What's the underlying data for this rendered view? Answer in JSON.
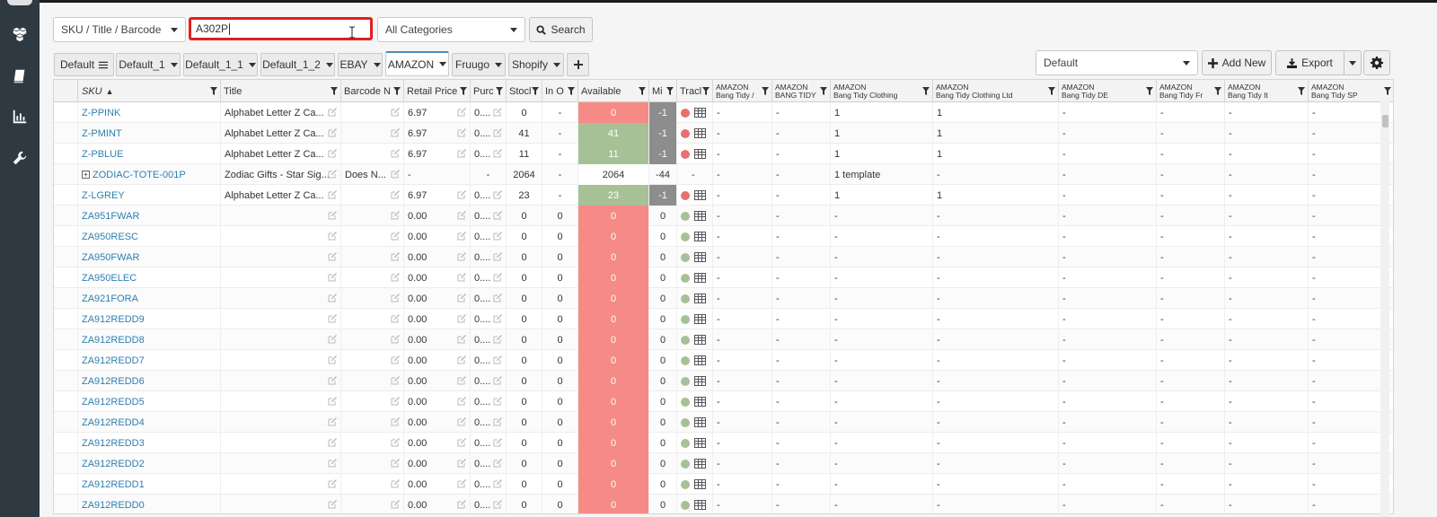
{
  "sidebar": {
    "items": [
      "boxes-icon",
      "book-icon",
      "chart-icon",
      "wrench-icon"
    ]
  },
  "filters": {
    "field_select": "SKU / Title / Barcode",
    "search_value": "A302P",
    "category_select": "All Categories",
    "search_label": "Search"
  },
  "tabs": [
    {
      "label": "Default",
      "active": false
    },
    {
      "label": "Default_1",
      "active": false
    },
    {
      "label": "Default_1_1",
      "active": false
    },
    {
      "label": "Default_1_2",
      "active": false
    },
    {
      "label": "EBAY",
      "active": false
    },
    {
      "label": "AMAZON",
      "active": true
    },
    {
      "label": "Fruugo",
      "active": false
    },
    {
      "label": "Shopify",
      "active": false
    }
  ],
  "toolbar": {
    "view_select": "Default",
    "add_new": "Add New",
    "export": "Export"
  },
  "columns": [
    "SKU",
    "Title",
    "Barcode N",
    "Retail Price",
    "Purc",
    "Stocl",
    "In O",
    "Available",
    "Mi",
    "Tracl",
    "AMAZON|Bang Tidy /",
    "AMAZON|BANG TIDY",
    "AMAZON|Bang Tidy Clothing",
    "AMAZON|Bang Tidy Clothing Ltd",
    "AMAZON|Bang Tidy DE",
    "AMAZON|Bang Tidy Fr",
    "AMAZON|Bang Tidy It",
    "AMAZON|Bang Tidy SP"
  ],
  "rows": [
    {
      "sku": "Z-PPINK",
      "title": "Alphabet Letter Z Ca...",
      "barcode": "",
      "price": "6.97",
      "purc": "0....",
      "stock": "0",
      "inorder": "-",
      "available": "0",
      "avail_color": "red",
      "mi": "-1",
      "track": "red",
      "a1": "-",
      "a2": "-",
      "a3": "1",
      "a4": "1",
      "a5": "-",
      "a6": "-",
      "a7": "-",
      "a8": "-",
      "expand": false
    },
    {
      "sku": "Z-PMINT",
      "title": "Alphabet Letter Z Ca...",
      "barcode": "",
      "price": "6.97",
      "purc": "0....",
      "stock": "41",
      "inorder": "-",
      "available": "41",
      "avail_color": "green",
      "mi": "-1",
      "track": "red",
      "a1": "-",
      "a2": "-",
      "a3": "1",
      "a4": "1",
      "a5": "-",
      "a6": "-",
      "a7": "-",
      "a8": "-",
      "expand": false
    },
    {
      "sku": "Z-PBLUE",
      "title": "Alphabet Letter Z Ca...",
      "barcode": "",
      "price": "6.97",
      "purc": "0....",
      "stock": "11",
      "inorder": "-",
      "available": "11",
      "avail_color": "green",
      "mi": "-1",
      "track": "red",
      "a1": "-",
      "a2": "-",
      "a3": "1",
      "a4": "1",
      "a5": "-",
      "a6": "-",
      "a7": "-",
      "a8": "-",
      "expand": false
    },
    {
      "sku": "ZODIAC-TOTE-001P",
      "title": "Zodiac Gifts - Star Sig...",
      "barcode": "Does N...",
      "price": "-",
      "purc": "-",
      "stock": "2064",
      "inorder": "-",
      "available": "2064",
      "avail_color": "white",
      "mi": "-44",
      "track": "none",
      "a1": "-",
      "a2": "-",
      "a3": "1 template",
      "a4": "-",
      "a5": "-",
      "a6": "-",
      "a7": "-",
      "a8": "-",
      "expand": true
    },
    {
      "sku": "Z-LGREY",
      "title": "Alphabet Letter Z Ca...",
      "barcode": "",
      "price": "6.97",
      "purc": "0....",
      "stock": "23",
      "inorder": "-",
      "available": "23",
      "avail_color": "green",
      "mi": "-1",
      "track": "red",
      "a1": "-",
      "a2": "-",
      "a3": "1",
      "a4": "1",
      "a5": "-",
      "a6": "-",
      "a7": "-",
      "a8": "-",
      "expand": false
    },
    {
      "sku": "ZA951FWAR",
      "title": "",
      "barcode": "",
      "price": "0.00",
      "purc": "0....",
      "stock": "0",
      "inorder": "0",
      "available": "0",
      "avail_color": "red",
      "mi": "0",
      "track": "green",
      "a1": "-",
      "a2": "-",
      "a3": "-",
      "a4": "-",
      "a5": "-",
      "a6": "-",
      "a7": "-",
      "a8": "-",
      "expand": false
    },
    {
      "sku": "ZA950RESC",
      "title": "",
      "barcode": "",
      "price": "0.00",
      "purc": "0....",
      "stock": "0",
      "inorder": "0",
      "available": "0",
      "avail_color": "red",
      "mi": "0",
      "track": "green",
      "a1": "-",
      "a2": "-",
      "a3": "-",
      "a4": "-",
      "a5": "-",
      "a6": "-",
      "a7": "-",
      "a8": "-",
      "expand": false
    },
    {
      "sku": "ZA950FWAR",
      "title": "",
      "barcode": "",
      "price": "0.00",
      "purc": "0....",
      "stock": "0",
      "inorder": "0",
      "available": "0",
      "avail_color": "red",
      "mi": "0",
      "track": "green",
      "a1": "-",
      "a2": "-",
      "a3": "-",
      "a4": "-",
      "a5": "-",
      "a6": "-",
      "a7": "-",
      "a8": "-",
      "expand": false
    },
    {
      "sku": "ZA950ELEC",
      "title": "",
      "barcode": "",
      "price": "0.00",
      "purc": "0....",
      "stock": "0",
      "inorder": "0",
      "available": "0",
      "avail_color": "red",
      "mi": "0",
      "track": "green",
      "a1": "-",
      "a2": "-",
      "a3": "-",
      "a4": "-",
      "a5": "-",
      "a6": "-",
      "a7": "-",
      "a8": "-",
      "expand": false
    },
    {
      "sku": "ZA921FORA",
      "title": "",
      "barcode": "",
      "price": "0.00",
      "purc": "0....",
      "stock": "0",
      "inorder": "0",
      "available": "0",
      "avail_color": "red",
      "mi": "0",
      "track": "green",
      "a1": "-",
      "a2": "-",
      "a3": "-",
      "a4": "-",
      "a5": "-",
      "a6": "-",
      "a7": "-",
      "a8": "-",
      "expand": false
    },
    {
      "sku": "ZA912REDD9",
      "title": "",
      "barcode": "",
      "price": "0.00",
      "purc": "0....",
      "stock": "0",
      "inorder": "0",
      "available": "0",
      "avail_color": "red",
      "mi": "0",
      "track": "green",
      "a1": "-",
      "a2": "-",
      "a3": "-",
      "a4": "-",
      "a5": "-",
      "a6": "-",
      "a7": "-",
      "a8": "-",
      "expand": false
    },
    {
      "sku": "ZA912REDD8",
      "title": "",
      "barcode": "",
      "price": "0.00",
      "purc": "0....",
      "stock": "0",
      "inorder": "0",
      "available": "0",
      "avail_color": "red",
      "mi": "0",
      "track": "green",
      "a1": "-",
      "a2": "-",
      "a3": "-",
      "a4": "-",
      "a5": "-",
      "a6": "-",
      "a7": "-",
      "a8": "-",
      "expand": false
    },
    {
      "sku": "ZA912REDD7",
      "title": "",
      "barcode": "",
      "price": "0.00",
      "purc": "0....",
      "stock": "0",
      "inorder": "0",
      "available": "0",
      "avail_color": "red",
      "mi": "0",
      "track": "green",
      "a1": "-",
      "a2": "-",
      "a3": "-",
      "a4": "-",
      "a5": "-",
      "a6": "-",
      "a7": "-",
      "a8": "-",
      "expand": false
    },
    {
      "sku": "ZA912REDD6",
      "title": "",
      "barcode": "",
      "price": "0.00",
      "purc": "0....",
      "stock": "0",
      "inorder": "0",
      "available": "0",
      "avail_color": "red",
      "mi": "0",
      "track": "green",
      "a1": "-",
      "a2": "-",
      "a3": "-",
      "a4": "-",
      "a5": "-",
      "a6": "-",
      "a7": "-",
      "a8": "-",
      "expand": false
    },
    {
      "sku": "ZA912REDD5",
      "title": "",
      "barcode": "",
      "price": "0.00",
      "purc": "0....",
      "stock": "0",
      "inorder": "0",
      "available": "0",
      "avail_color": "red",
      "mi": "0",
      "track": "green",
      "a1": "-",
      "a2": "-",
      "a3": "-",
      "a4": "-",
      "a5": "-",
      "a6": "-",
      "a7": "-",
      "a8": "-",
      "expand": false
    },
    {
      "sku": "ZA912REDD4",
      "title": "",
      "barcode": "",
      "price": "0.00",
      "purc": "0....",
      "stock": "0",
      "inorder": "0",
      "available": "0",
      "avail_color": "red",
      "mi": "0",
      "track": "green",
      "a1": "-",
      "a2": "-",
      "a3": "-",
      "a4": "-",
      "a5": "-",
      "a6": "-",
      "a7": "-",
      "a8": "-",
      "expand": false
    },
    {
      "sku": "ZA912REDD3",
      "title": "",
      "barcode": "",
      "price": "0.00",
      "purc": "0....",
      "stock": "0",
      "inorder": "0",
      "available": "0",
      "avail_color": "red",
      "mi": "0",
      "track": "green",
      "a1": "-",
      "a2": "-",
      "a3": "-",
      "a4": "-",
      "a5": "-",
      "a6": "-",
      "a7": "-",
      "a8": "-",
      "expand": false
    },
    {
      "sku": "ZA912REDD2",
      "title": "",
      "barcode": "",
      "price": "0.00",
      "purc": "0....",
      "stock": "0",
      "inorder": "0",
      "available": "0",
      "avail_color": "red",
      "mi": "0",
      "track": "green",
      "a1": "-",
      "a2": "-",
      "a3": "-",
      "a4": "-",
      "a5": "-",
      "a6": "-",
      "a7": "-",
      "a8": "-",
      "expand": false
    },
    {
      "sku": "ZA912REDD1",
      "title": "",
      "barcode": "",
      "price": "0.00",
      "purc": "0....",
      "stock": "0",
      "inorder": "0",
      "available": "0",
      "avail_color": "red",
      "mi": "0",
      "track": "green",
      "a1": "-",
      "a2": "-",
      "a3": "-",
      "a4": "-",
      "a5": "-",
      "a6": "-",
      "a7": "-",
      "a8": "-",
      "expand": false
    },
    {
      "sku": "ZA912REDD0",
      "title": "",
      "barcode": "",
      "price": "0.00",
      "purc": "0....",
      "stock": "0",
      "inorder": "0",
      "available": "0",
      "avail_color": "red",
      "mi": "0",
      "track": "green",
      "a1": "-",
      "a2": "-",
      "a3": "-",
      "a4": "-",
      "a5": "-",
      "a6": "-",
      "a7": "-",
      "a8": "-",
      "expand": false
    }
  ],
  "colors": {
    "accent": "#2f7fb0",
    "available_red": "#f58a86",
    "available_green": "#a7c196",
    "track_red": "#e8706f",
    "track_green": "#a7c196",
    "highlight": "#e01f1f"
  }
}
